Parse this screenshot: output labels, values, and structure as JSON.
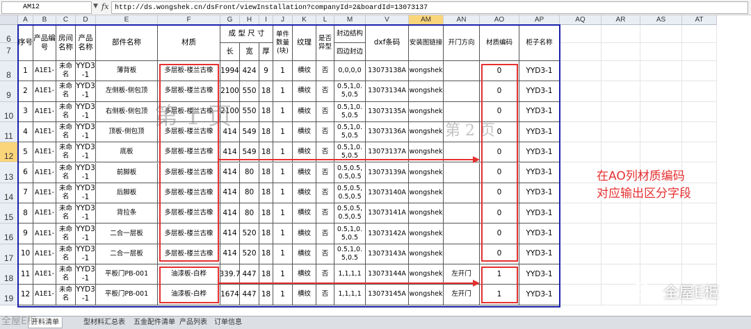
{
  "formula_bar": {
    "name_box": "AM12",
    "fx": "fx",
    "formula": "http://ds.wongshek.cn/dsFront/viewInstallation?companyId=2&boardId=13073137"
  },
  "columns": [
    {
      "id": "A",
      "label": "A"
    },
    {
      "id": "B",
      "label": "B"
    },
    {
      "id": "C",
      "label": "C"
    },
    {
      "id": "D",
      "label": "D"
    },
    {
      "id": "E",
      "label": "E"
    },
    {
      "id": "F",
      "label": "F"
    },
    {
      "id": "G",
      "label": "G"
    },
    {
      "id": "H",
      "label": "H"
    },
    {
      "id": "I",
      "label": "I"
    },
    {
      "id": "J",
      "label": "J"
    },
    {
      "id": "K",
      "label": "K"
    },
    {
      "id": "L",
      "label": "L"
    },
    {
      "id": "M",
      "label": "M"
    },
    {
      "id": "V",
      "label": "V"
    },
    {
      "id": "AM",
      "label": "AM"
    },
    {
      "id": "AN",
      "label": "AN"
    },
    {
      "id": "AO",
      "label": "AO"
    },
    {
      "id": "AP",
      "label": "AP"
    },
    {
      "id": "AQ",
      "label": "AQ"
    },
    {
      "id": "AR",
      "label": "AR"
    },
    {
      "id": "AS",
      "label": "AS"
    },
    {
      "id": "AT",
      "label": "AT"
    }
  ],
  "selected_column": "AM",
  "selected_row": "12",
  "header": {
    "row6": "6",
    "row7": "7",
    "seq": "序号",
    "product_code": "产品编号",
    "room_name": "房间名称",
    "product_name": "产品名称",
    "part_name": "部件名称",
    "material": "材质",
    "finished_size": "成 型 尺 寸",
    "length": "长",
    "width": "宽",
    "thickness": "厚",
    "unit_qty": "单件数量(块)",
    "texture": "纹理",
    "special_shape": "是否异型",
    "edge_structure": "封边结构",
    "four_edge": "四边封边",
    "dxf_barcode": "dxf条码",
    "install_link": "安装图链接",
    "door_dir": "开门方向",
    "material_code": "材质编码",
    "cabinet_name": "柜子名称"
  },
  "rows": [
    {
      "row": "8",
      "seq": "1",
      "code": "A1E1-",
      "room": "未命名",
      "product": "YYD3-1",
      "part": "薄背板",
      "material": "多层板-楼兰古橡",
      "l": "1994",
      "w": "424",
      "t": "9",
      "qty": "1",
      "texture": "横纹",
      "shape": "否",
      "edge": "0,0,0,0",
      "dxf": "13073138A",
      "link": "wongshek",
      "door": "",
      "mcode": "0",
      "cabinet": "YYD3-1"
    },
    {
      "row": "9",
      "seq": "2",
      "code": "A1E1-",
      "room": "未命名",
      "product": "YYD3-1",
      "part": "左侧板-侧包顶",
      "material": "多层板-楼兰古橡",
      "l": "2100",
      "w": "550",
      "t": "18",
      "qty": "1",
      "texture": "横纹",
      "shape": "否",
      "edge": "0.5,1,0.5,0.5",
      "dxf": "13073134A",
      "link": "wongshek",
      "door": "",
      "mcode": "0",
      "cabinet": "YYD3-1"
    },
    {
      "row": "10",
      "seq": "3",
      "code": "A1E1-",
      "room": "未命名",
      "product": "YYD3-1",
      "part": "右侧板-侧包顶",
      "material": "多层板-楼兰古橡",
      "l": "2100",
      "w": "550",
      "t": "18",
      "qty": "1",
      "texture": "横纹",
      "shape": "否",
      "edge": "0.5,1,0.5,0.5",
      "dxf": "13073135A",
      "link": "wongshek",
      "door": "",
      "mcode": "0",
      "cabinet": "YYD3-1"
    },
    {
      "row": "11",
      "seq": "4",
      "code": "A1E1-",
      "room": "未命名",
      "product": "YYD3-1",
      "part": "顶板-侧包顶",
      "material": "多层板-楼兰古橡",
      "l": "414",
      "w": "549",
      "t": "18",
      "qty": "1",
      "texture": "横纹",
      "shape": "否",
      "edge": "0.5,1,0.5,0.5",
      "dxf": "13073136A",
      "link": "wongshek",
      "door": "",
      "mcode": "0",
      "cabinet": "YYD3-1"
    },
    {
      "row": "12",
      "seq": "5",
      "code": "A1E1-",
      "room": "未命名",
      "product": "YYD3-1",
      "part": "底板",
      "material": "多层板-楼兰古橡",
      "l": "414",
      "w": "549",
      "t": "18",
      "qty": "1",
      "texture": "横纹",
      "shape": "否",
      "edge": "0.5,1,0.5,0.5",
      "dxf": "13073137A",
      "link": "wongshek",
      "door": "",
      "mcode": "0",
      "cabinet": "YYD3-1"
    },
    {
      "row": "13",
      "seq": "6",
      "code": "A1E1-",
      "room": "未命名",
      "product": "YYD3-1",
      "part": "前脚板",
      "material": "多层板-楼兰古橡",
      "l": "414",
      "w": "80",
      "t": "18",
      "qty": "1",
      "texture": "横纹",
      "shape": "否",
      "edge": "0.5,0.5,0.5,0.5",
      "dxf": "13073139A",
      "link": "wongshek",
      "door": "",
      "mcode": "0",
      "cabinet": "YYD3-1"
    },
    {
      "row": "14",
      "seq": "7",
      "code": "A1E1-",
      "room": "未命名",
      "product": "YYD3-1",
      "part": "后脚板",
      "material": "多层板-楼兰古橡",
      "l": "414",
      "w": "80",
      "t": "18",
      "qty": "1",
      "texture": "横纹",
      "shape": "否",
      "edge": "0.5,0.5,0.5,0.5",
      "dxf": "13073140A",
      "link": "wongshek",
      "door": "",
      "mcode": "0",
      "cabinet": "YYD3-1"
    },
    {
      "row": "15",
      "seq": "8",
      "code": "A1E1-",
      "room": "未命名",
      "product": "YYD3-1",
      "part": "背拉条",
      "material": "多层板-楼兰古橡",
      "l": "414",
      "w": "80",
      "t": "18",
      "qty": "1",
      "texture": "横纹",
      "shape": "否",
      "edge": "0.5,0.5,0.5,0.5",
      "dxf": "13073141A",
      "link": "wongshek",
      "door": "",
      "mcode": "0",
      "cabinet": "YYD3-1"
    },
    {
      "row": "16",
      "seq": "9",
      "code": "A1E1-",
      "room": "未命名",
      "product": "YYD3-1",
      "part": "二合一层板",
      "material": "多层板-楼兰古橡",
      "l": "414",
      "w": "520",
      "t": "18",
      "qty": "1",
      "texture": "横纹",
      "shape": "否",
      "edge": "0.5,1,0.5,0.5",
      "dxf": "13073142A",
      "link": "wongshek",
      "door": "",
      "mcode": "0",
      "cabinet": "YYD3-1"
    },
    {
      "row": "17",
      "seq": "10",
      "code": "A1E1-",
      "room": "未命名",
      "product": "YYD3-1",
      "part": "二合一层板",
      "material": "多层板-楼兰古橡",
      "l": "414",
      "w": "520",
      "t": "18",
      "qty": "1",
      "texture": "横纹",
      "shape": "否",
      "edge": "0.5,1,0.5,0.5",
      "dxf": "13073143A",
      "link": "wongshek",
      "door": "",
      "mcode": "0",
      "cabinet": "YYD3-1"
    },
    {
      "row": "18",
      "seq": "11",
      "code": "A1E1-",
      "room": "未命名",
      "product": "YYD3-1",
      "part": "平板门PB-001",
      "material": "油漆板-白桦",
      "l": "339.7",
      "w": "447",
      "t": "18",
      "qty": "1",
      "texture": "横纹",
      "shape": "否",
      "edge": "1,1,1,1",
      "dxf": "13073144A",
      "link": "wongshek",
      "door": "左开门",
      "mcode": "1",
      "cabinet": "YYD3-1"
    },
    {
      "row": "19",
      "seq": "12",
      "code": "A1E1-",
      "room": "未命名",
      "product": "YYD3-1",
      "part": "平板门PB-001",
      "material": "油漆板-白桦",
      "l": "1674",
      "w": "447",
      "t": "18",
      "qty": "1",
      "texture": "横纹",
      "shape": "否",
      "edge": "1,1,1,1",
      "dxf": "13073145A",
      "link": "wongshek",
      "door": "左开门",
      "mcode": "1",
      "cabinet": "YYD3-1"
    }
  ],
  "watermarks": {
    "page1": "第 1 页",
    "page2": "第 2 页"
  },
  "annotation": {
    "line1": "在AO列材质编码",
    "line2": "对应输出区分字段"
  },
  "sheet_tabs": [
    {
      "label": "开料清单",
      "active": true
    },
    {
      "label": "型材料汇总表",
      "active": false
    },
    {
      "label": "五金配件清单",
      "active": false
    },
    {
      "label": "产品列表",
      "active": false
    },
    {
      "label": "订单信息",
      "active": false
    }
  ],
  "brand": {
    "name": "全屋E柜",
    "small": "全屋E柜"
  },
  "colors": {
    "red": "#e53030",
    "blue_border": "#1a23a8",
    "selected_header": "#fbd57a"
  }
}
